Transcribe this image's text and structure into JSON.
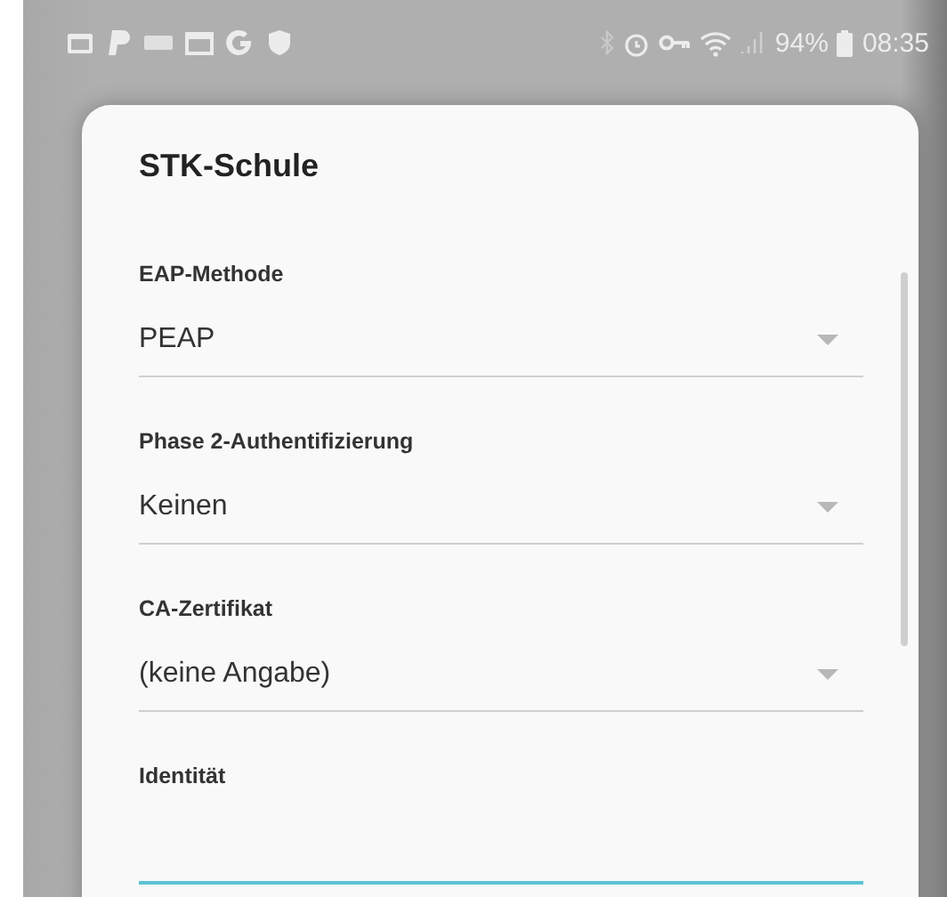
{
  "status_bar": {
    "battery_percent": "94%",
    "time": "08:35"
  },
  "dialog": {
    "title": "STK-Schule",
    "fields": [
      {
        "kind": "dropdown",
        "label": "EAP-Methode",
        "value": "PEAP",
        "focused": false
      },
      {
        "kind": "dropdown",
        "label": "Phase 2-Authentifizierung",
        "value": "Keinen",
        "focused": false
      },
      {
        "kind": "dropdown",
        "label": "CA-Zertifikat",
        "value": "(keine Angabe)",
        "focused": false
      },
      {
        "kind": "text",
        "label": "Identität",
        "focused": true
      }
    ]
  }
}
